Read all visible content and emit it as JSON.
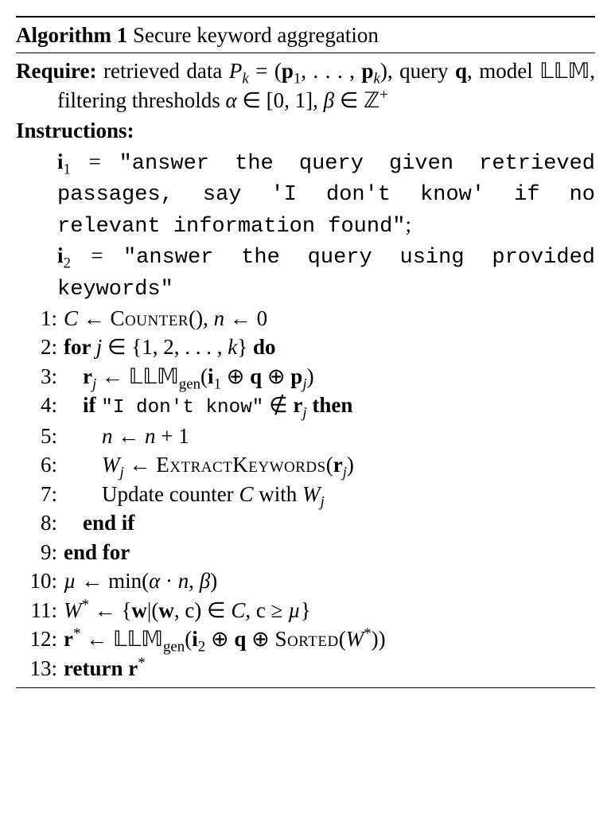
{
  "title_prefix": "Algorithm 1",
  "title_rest": " Secure keyword aggregation",
  "require_label": "Require:",
  "require_text_1": " retrieved data ",
  "require_Pk": "P",
  "require_k": "k",
  "require_eq": " = (",
  "require_p1": "p",
  "require_1": "1",
  "require_dots": ", . . . , ",
  "require_pk2": "p",
  "require_k2": "k",
  "require_close": "), query ",
  "require_q": "q",
  "require_model": ", model ",
  "require_LLM": "𝕃𝕃𝕄",
  "require_filter": ", filtering thresholds ",
  "require_alpha": "α",
  "require_in1": " ∈ [0, 1], ",
  "require_beta": "β",
  "require_in2": " ∈ ",
  "require_Z": "ℤ",
  "require_plus": "+",
  "instructions_label": "Instructions:",
  "i1_lhs": "i",
  "i1_sub": "1",
  "i1_eq": " = ",
  "i1_text": "\"answer the query given retrieved passages, say 'I don't know' if no relevant information found\"",
  "i1_semi": ";",
  "i2_lhs": "i",
  "i2_sub": "2",
  "i2_eq": " = ",
  "i2_text": "\"answer the query using provided keywords\"",
  "lines": {
    "l1_num": "1:",
    "l1_C": "C",
    "l1_arrow": " ← ",
    "l1_counter": "Counter",
    "l1_paren": "(), ",
    "l1_n": "n",
    "l1_arrow2": " ← 0",
    "l2_num": "2:",
    "l2_for": "for ",
    "l2_j": "j",
    "l2_in": " ∈ {1, 2, . . . , ",
    "l2_k": "k",
    "l2_close": "} ",
    "l2_do": "do",
    "l3_num": "3:",
    "l3_r": "r",
    "l3_j": "j",
    "l3_arrow": " ← ",
    "l3_LLM": "𝕃𝕃𝕄",
    "l3_gen": "gen",
    "l3_open": "(",
    "l3_i": "i",
    "l3_1": "1",
    "l3_oplus1": " ⊕ ",
    "l3_q": "q",
    "l3_oplus2": " ⊕ ",
    "l3_p": "p",
    "l3_j2": "j",
    "l3_close": ")",
    "l4_num": "4:",
    "l4_if": "if ",
    "l4_str": "\"I don't know\"",
    "l4_notin": " ∉ ",
    "l4_r": "r",
    "l4_j": "j",
    "l4_then": " then",
    "l5_num": "5:",
    "l5_n": "n",
    "l5_arrow": " ← ",
    "l5_n2": "n",
    "l5_plus": " + 1",
    "l6_num": "6:",
    "l6_W": "W",
    "l6_j": "j",
    "l6_arrow": " ← ",
    "l6_ek": "ExtractKeywords",
    "l6_open": "(",
    "l6_r": "r",
    "l6_j2": "j",
    "l6_close": ")",
    "l7_num": "7:",
    "l7_text1": "Update counter ",
    "l7_C": "C",
    "l7_text2": " with ",
    "l7_W": "W",
    "l7_j": "j",
    "l8_num": "8:",
    "l8_endif": "end if",
    "l9_num": "9:",
    "l9_endfor": "end for",
    "l10_num": "10:",
    "l10_mu": "µ",
    "l10_arrow": " ← min(",
    "l10_alpha": "α",
    "l10_cdot": " · ",
    "l10_n": "n",
    "l10_comma": ", ",
    "l10_beta": "β",
    "l10_close": ")",
    "l11_num": "11:",
    "l11_W": "W",
    "l11_star": "*",
    "l11_arrow": " ← {",
    "l11_w": "w",
    "l11_bar": "|(",
    "l11_w2": "w",
    "l11_c": ", c) ∈ ",
    "l11_C": "C",
    "l11_geq": ", c ≥ ",
    "l11_mu": "µ",
    "l11_close": "}",
    "l12_num": "12:",
    "l12_r": "r",
    "l12_star": "*",
    "l12_arrow": " ← ",
    "l12_LLM": "𝕃𝕃𝕄",
    "l12_gen": "gen",
    "l12_open": "(",
    "l12_i": "i",
    "l12_2": "2",
    "l12_oplus1": " ⊕ ",
    "l12_q": "q",
    "l12_oplus2": " ⊕ ",
    "l12_sorted": "Sorted",
    "l12_open2": "(",
    "l12_W": "W",
    "l12_star2": "*",
    "l12_close": "))",
    "l13_num": "13:",
    "l13_return": "return ",
    "l13_r": "r",
    "l13_star": "*"
  }
}
